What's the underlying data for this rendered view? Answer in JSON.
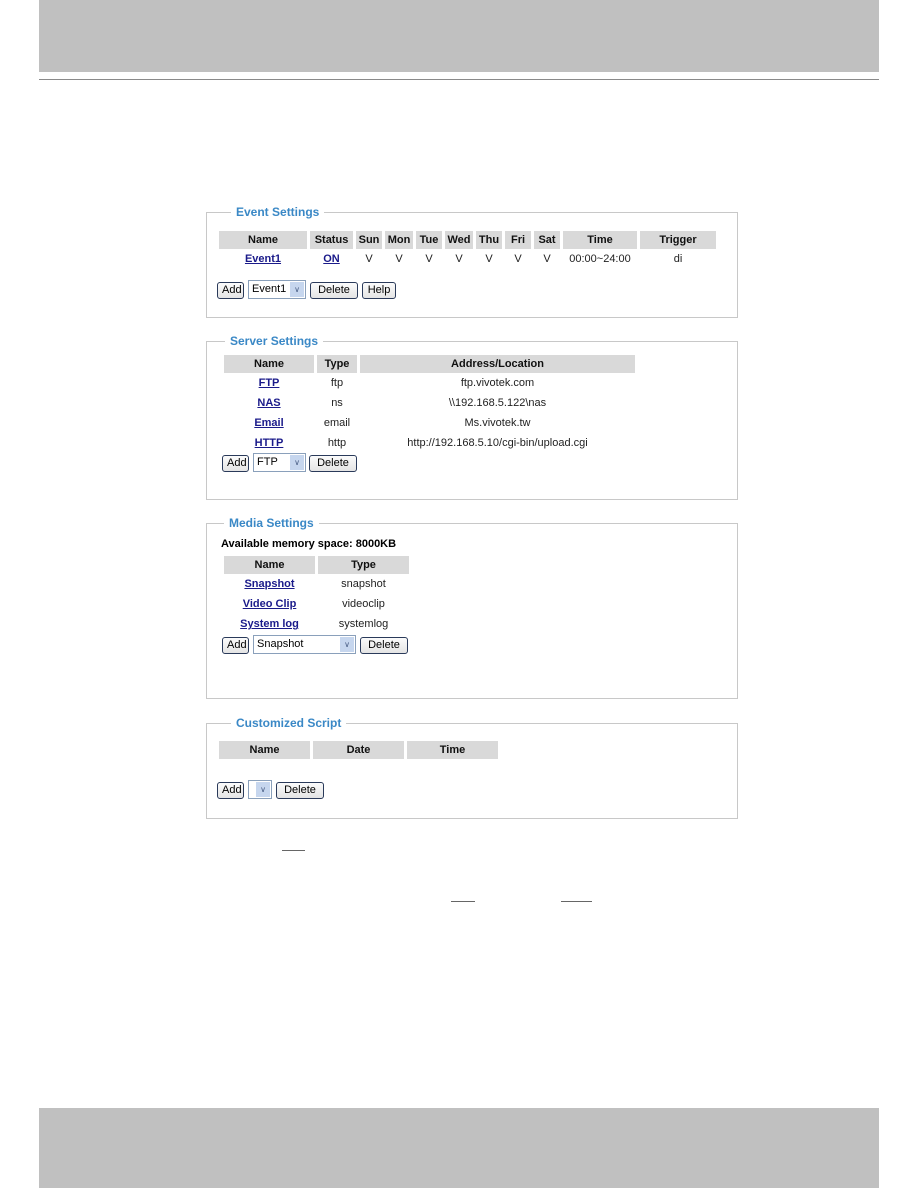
{
  "event_settings": {
    "title": "Event Settings",
    "columns": [
      "Name",
      "Status",
      "Sun",
      "Mon",
      "Tue",
      "Wed",
      "Thu",
      "Fri",
      "Sat",
      "Time",
      "Trigger"
    ],
    "rows": [
      {
        "name": "Event1",
        "status": "ON",
        "sun": "V",
        "mon": "V",
        "tue": "V",
        "wed": "V",
        "thu": "V",
        "fri": "V",
        "sat": "V",
        "time": "00:00~24:00",
        "trigger": "di"
      }
    ],
    "add_label": "Add",
    "selected": "Event1",
    "delete_label": "Delete",
    "help_label": "Help"
  },
  "server_settings": {
    "title": "Server Settings",
    "columns": [
      "Name",
      "Type",
      "Address/Location"
    ],
    "rows": [
      {
        "name": "FTP",
        "type": "ftp",
        "address": "ftp.vivotek.com"
      },
      {
        "name": "NAS",
        "type": "ns",
        "address": "\\\\192.168.5.122\\nas"
      },
      {
        "name": "Email",
        "type": "email",
        "address": "Ms.vivotek.tw"
      },
      {
        "name": "HTTP",
        "type": "http",
        "address": "http://192.168.5.10/cgi-bin/upload.cgi"
      }
    ],
    "add_label": "Add",
    "selected": "FTP",
    "delete_label": "Delete"
  },
  "media_settings": {
    "title": "Media Settings",
    "memory": "Available memory space: 8000KB",
    "columns": [
      "Name",
      "Type"
    ],
    "rows": [
      {
        "name": "Snapshot",
        "type": "snapshot"
      },
      {
        "name": "Video Clip",
        "type": "videoclip"
      },
      {
        "name": "System log",
        "type": "systemlog"
      }
    ],
    "add_label": "Add",
    "selected": "Snapshot",
    "delete_label": "Delete"
  },
  "customized_script": {
    "title": "Customized Script",
    "columns": [
      "Name",
      "Date",
      "Time"
    ],
    "add_label": "Add",
    "selected": "",
    "delete_label": "Delete"
  },
  "icons": {
    "dropdown": "chevron-down-icon",
    "arrow_glyph": "∨"
  }
}
